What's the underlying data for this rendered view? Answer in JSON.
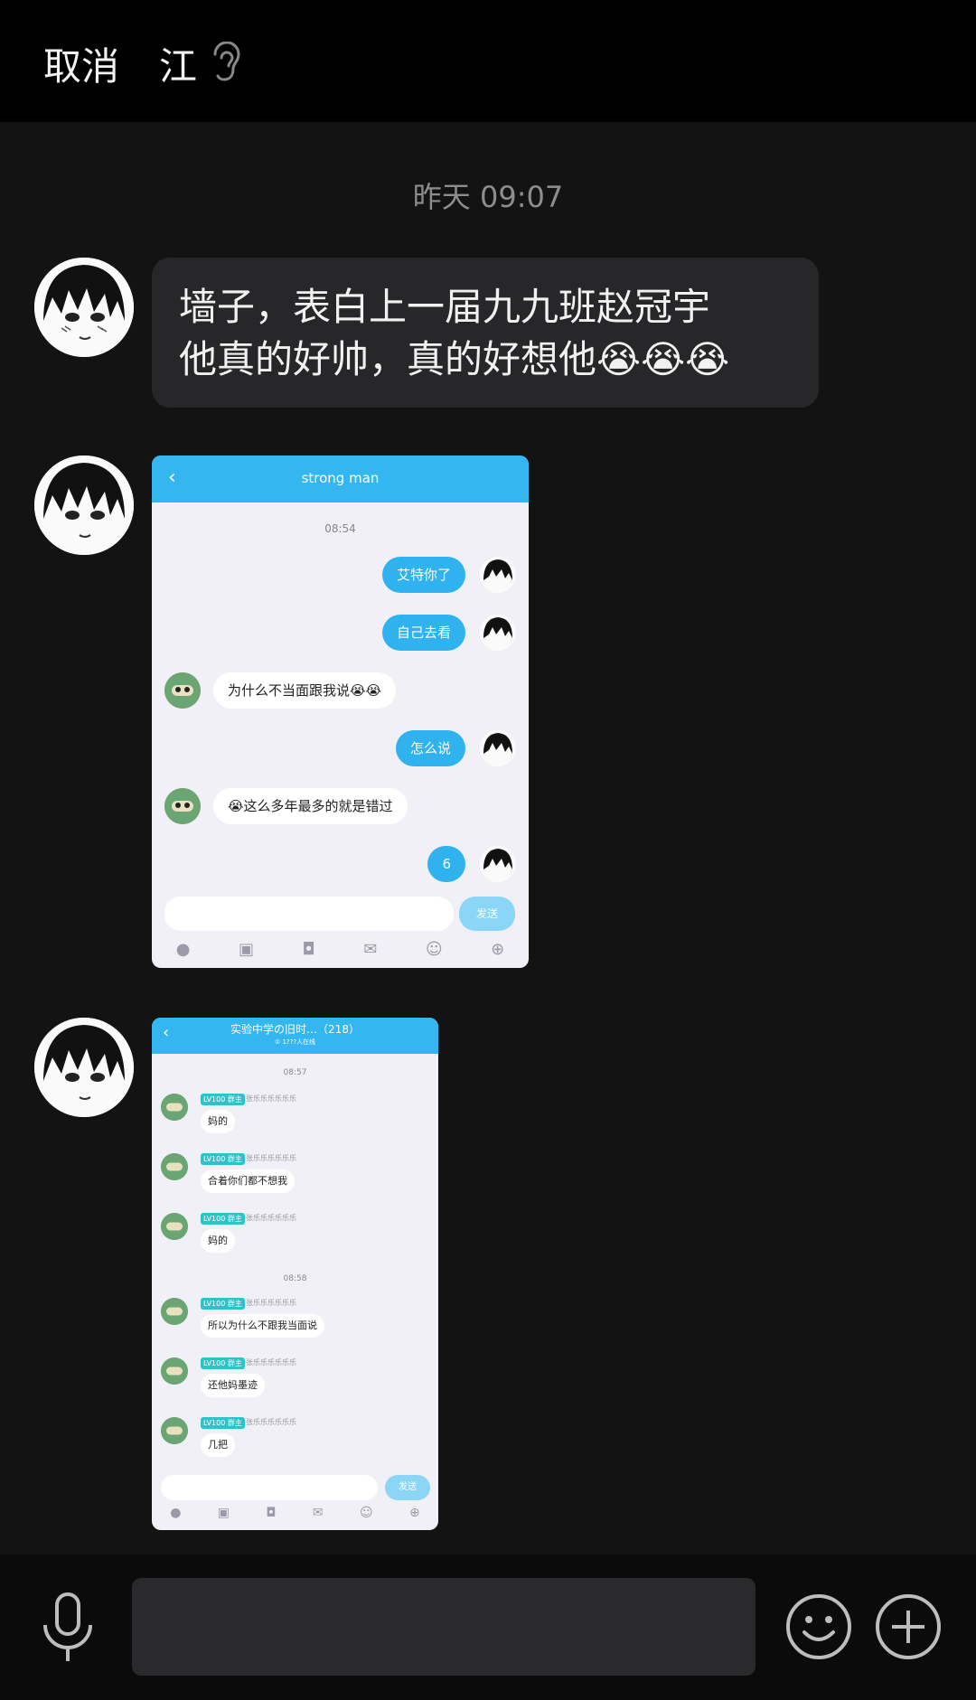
{
  "header": {
    "cancel_label": "取消",
    "contact_name": "江",
    "ear_icon": "ear-icon"
  },
  "chat": {
    "timestamp": "昨天 09:07",
    "messages": [
      {
        "type": "text",
        "lines": [
          "墙子，表白上一届九九班赵冠宇",
          "他真的好帅，真的好想他😭😭😭"
        ]
      },
      {
        "type": "image",
        "screenshot": {
          "title": "strong man",
          "time": "08:54",
          "messages": [
            {
              "side": "right",
              "text": "艾特你了"
            },
            {
              "side": "right",
              "text": "自己去看"
            },
            {
              "side": "left",
              "text": "为什么不当面跟我说😭😭"
            },
            {
              "side": "right",
              "text": "怎么说"
            },
            {
              "side": "left",
              "text": "😭这么多年最多的就是错过"
            },
            {
              "side": "right",
              "text": "6"
            }
          ],
          "send_label": "发送"
        }
      },
      {
        "type": "image",
        "screenshot": {
          "title": "实验中学の旧时…（218）",
          "subtitle": "① 1???人在线",
          "time1": "08:57",
          "time2": "08:58",
          "tag": "LV100 群主",
          "tag_text": "张乐乐乐乐乐乐",
          "messages_a": [
            "妈的",
            "合着你们都不想我",
            "妈的"
          ],
          "messages_b": [
            "所以为什么不跟我当面说",
            "还他妈墨迹",
            "几把"
          ],
          "send_label": "发送"
        }
      }
    ]
  },
  "bottom": {
    "input_value": "",
    "mic_icon": "mic-icon",
    "emoji_icon": "smile-icon",
    "plus_icon": "plus-icon"
  }
}
